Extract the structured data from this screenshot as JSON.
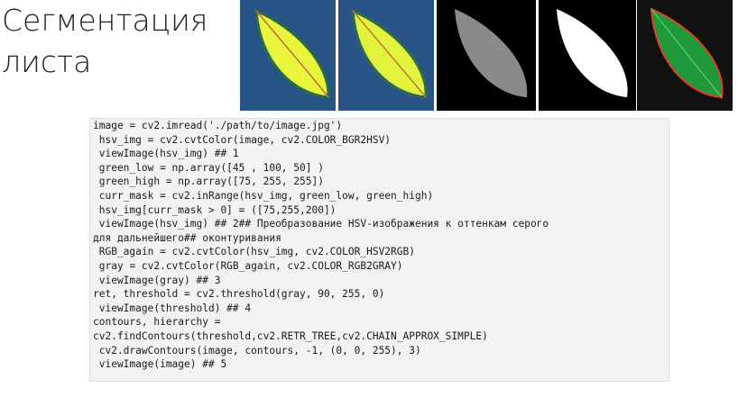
{
  "title": {
    "line1": "Сегментация",
    "line2": "листа"
  },
  "images": [
    {
      "name": "original-leaf-image",
      "icon": "leaf-blue-background"
    },
    {
      "name": "hsv-leaf-image",
      "icon": "leaf-blue-background"
    },
    {
      "name": "gray-leaf-image",
      "icon": "leaf-gray"
    },
    {
      "name": "threshold-leaf-image",
      "icon": "leaf-white-mask"
    },
    {
      "name": "contour-leaf-image",
      "icon": "leaf-green-contour"
    }
  ],
  "code": [
    "image = cv2.imread('./path/to/image.jpg')",
    " hsv_img = cv2.cvtColor(image, cv2.COLOR_BGR2HSV)",
    " viewImage(hsv_img) ## 1",
    " green_low = np.array([45 , 100, 50] )",
    " green_high = np.array([75, 255, 255])",
    " curr_mask = cv2.inRange(hsv_img, green_low, green_high)",
    " hsv_img[curr_mask > 0] = ([75,255,200])",
    " viewImage(hsv_img) ## 2## Преобразование HSV-изображения к оттенкам серого",
    "для дальнейшего## оконтуривания",
    " RGB_again = cv2.cvtColor(hsv_img, cv2.COLOR_HSV2RGB)",
    " gray = cv2.cvtColor(RGB_again, cv2.COLOR_RGB2GRAY)",
    " viewImage(gray) ## 3",
    "ret, threshold = cv2.threshold(gray, 90, 255, 0)",
    " viewImage(threshold) ## 4",
    "contours, hierarchy =",
    "cv2.findContours(threshold,cv2.RETR_TREE,cv2.CHAIN_APPROX_SIMPLE)",
    " cv2.drawContours(image, contours, -1, (0, 0, 255), 3)",
    " viewImage(image) ## 5"
  ]
}
